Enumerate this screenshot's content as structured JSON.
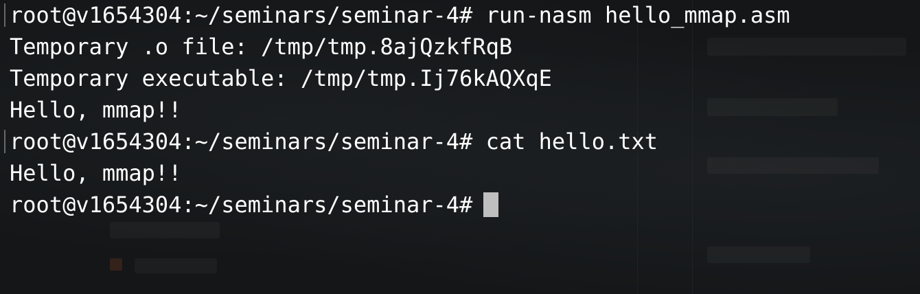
{
  "terminal": {
    "lines": [
      "root@v1654304:~/seminars/seminar-4# run-nasm hello_mmap.asm",
      "Temporary .o file: /tmp/tmp.8ajQzkfRqB",
      "Temporary executable: /tmp/tmp.Ij76kAQXqE",
      "Hello, mmap!!",
      "root@v1654304:~/seminars/seminar-4# cat hello.txt",
      "Hello, mmap!!",
      "root@v1654304:~/seminars/seminar-4#"
    ]
  },
  "colors": {
    "background": "#141618",
    "text": "#ffffff",
    "cursor": "#bfbfbf"
  }
}
